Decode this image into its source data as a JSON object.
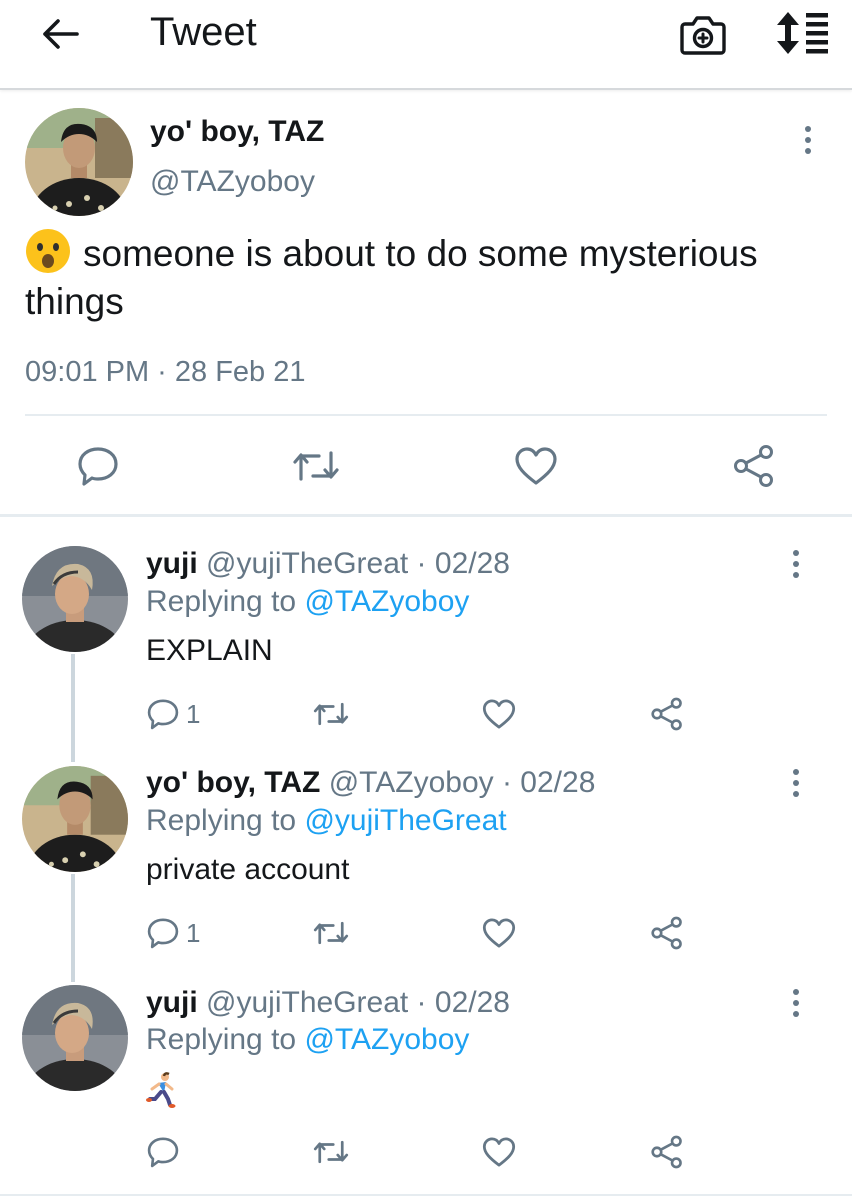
{
  "header": {
    "title": "Tweet",
    "back_icon": "arrow-left-icon",
    "camera_icon": "camera-plus-icon",
    "sort_icon": "sort-icon"
  },
  "tweet": {
    "name": "yo' boy, TAZ",
    "handle": "@TAZyoboy",
    "emoji_icon": "surprised-face-emoji",
    "text": "someone is about to do some mysterious things",
    "timestamp": "09:01 PM · 28 Feb 21"
  },
  "replies": [
    {
      "name": "yuji",
      "meta": "@yujiTheGreat · 02/28",
      "replying_prefix": "Replying to ",
      "replying_to": "@TAZyoboy",
      "body": "EXPLAIN",
      "reply_count": "1"
    },
    {
      "name": "yo' boy, TAZ",
      "meta": "@TAZyoboy · 02/28",
      "replying_prefix": "Replying to ",
      "replying_to": "@yujiTheGreat",
      "body": "private account",
      "reply_count": "1"
    },
    {
      "name": "yuji",
      "meta": "@yujiTheGreat · 02/28",
      "replying_prefix": "Replying to ",
      "replying_to": "@TAZyoboy",
      "body_emoji": "running-person-emoji",
      "reply_count": ""
    }
  ],
  "colors": {
    "link": "#1da1f2",
    "secondary_text": "#657786",
    "icon": "#657786",
    "divider": "#e6ecf0"
  }
}
